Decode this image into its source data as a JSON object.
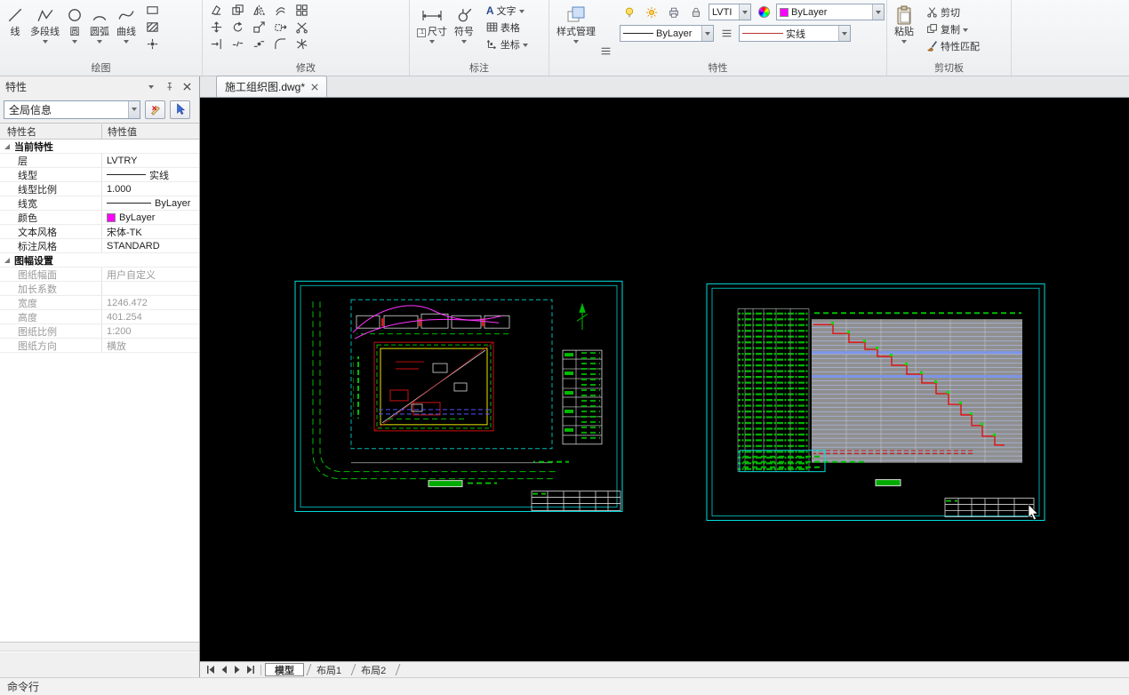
{
  "colors": {
    "accent_magenta": "#ff00ff",
    "sheet_cyan": "#00dede",
    "canvas_background": "#000000",
    "linetype_red": "#bb3333",
    "schedule_gray": "#8f8f8f"
  },
  "icons": [
    "line-icon",
    "polyline-icon",
    "circle-icon",
    "arc-icon",
    "spline-icon",
    "rectangle-icon",
    "hatch-icon",
    "erase-icon",
    "copy-icon",
    "mirror-icon",
    "offset-icon",
    "array-icon",
    "move-icon",
    "rotate-icon",
    "scale-icon",
    "stretch-icon",
    "trim-icon",
    "extend-icon",
    "break-icon",
    "join-icon",
    "fillet-icon",
    "explode-icon",
    "dimension-icon",
    "symbol-icon",
    "text-icon",
    "table-icon",
    "coordinate-icon",
    "style-manager-icon",
    "bulb-icon",
    "sun-icon",
    "printer-icon",
    "lock-icon",
    "color-wheel-icon",
    "menu-icon",
    "paste-icon",
    "cut-icon",
    "match-properties-icon",
    "pin-icon",
    "close-icon",
    "chevron-down-icon"
  ],
  "ribbon": {
    "draw": {
      "label": "绘图",
      "tools": [
        {
          "label": "线"
        },
        {
          "label": "多段线"
        },
        {
          "label": "圆"
        },
        {
          "label": "圆弧"
        },
        {
          "label": "曲线"
        }
      ]
    },
    "modify": {
      "label": "修改"
    },
    "annotate": {
      "label": "标注",
      "dim": "尺寸",
      "symbol": "符号",
      "text": "文字",
      "table": "表格",
      "coord": "坐标",
      "dim_icon_text": ".1",
      "text_icon_letter": "A"
    },
    "style_manager": {
      "label": "样式管理"
    },
    "properties": {
      "label": "特性",
      "layer": "LVTI",
      "color": "ByLayer",
      "linetype": "ByLayer",
      "linestyle": "实线"
    },
    "clipboard": {
      "label": "剪切板",
      "paste": "粘贴",
      "cut": "剪切",
      "copy": "复制",
      "match": "特性匹配"
    }
  },
  "panel": {
    "title": "特性",
    "scope": "全局信息",
    "col_name": "特性名",
    "col_value": "特性值",
    "g1": {
      "label": "当前特性",
      "rows": [
        {
          "n": "层",
          "v": "LVTRY"
        },
        {
          "n": "线型",
          "v": "实线"
        },
        {
          "n": "线型比例",
          "v": "1.000"
        },
        {
          "n": "线宽",
          "v": "ByLayer"
        },
        {
          "n": "颜色",
          "v": "ByLayer"
        },
        {
          "n": "文本风格",
          "v": "宋体-TK"
        },
        {
          "n": "标注风格",
          "v": "STANDARD"
        }
      ]
    },
    "g2": {
      "label": "图幅设置",
      "rows": [
        {
          "n": "图纸幅面",
          "v": "用户自定义"
        },
        {
          "n": "加长系数",
          "v": ""
        },
        {
          "n": "宽度",
          "v": "1246.472"
        },
        {
          "n": "高度",
          "v": "401.254"
        },
        {
          "n": "图纸比例",
          "v": "1:200"
        },
        {
          "n": "图纸方向",
          "v": "横放"
        }
      ]
    }
  },
  "document": {
    "tab": "施工组织图.dwg*"
  },
  "layout_tabs": {
    "model": "模型",
    "layout1": "布局1",
    "layout2": "布局2"
  },
  "statusbar": {
    "label": "命令行"
  }
}
